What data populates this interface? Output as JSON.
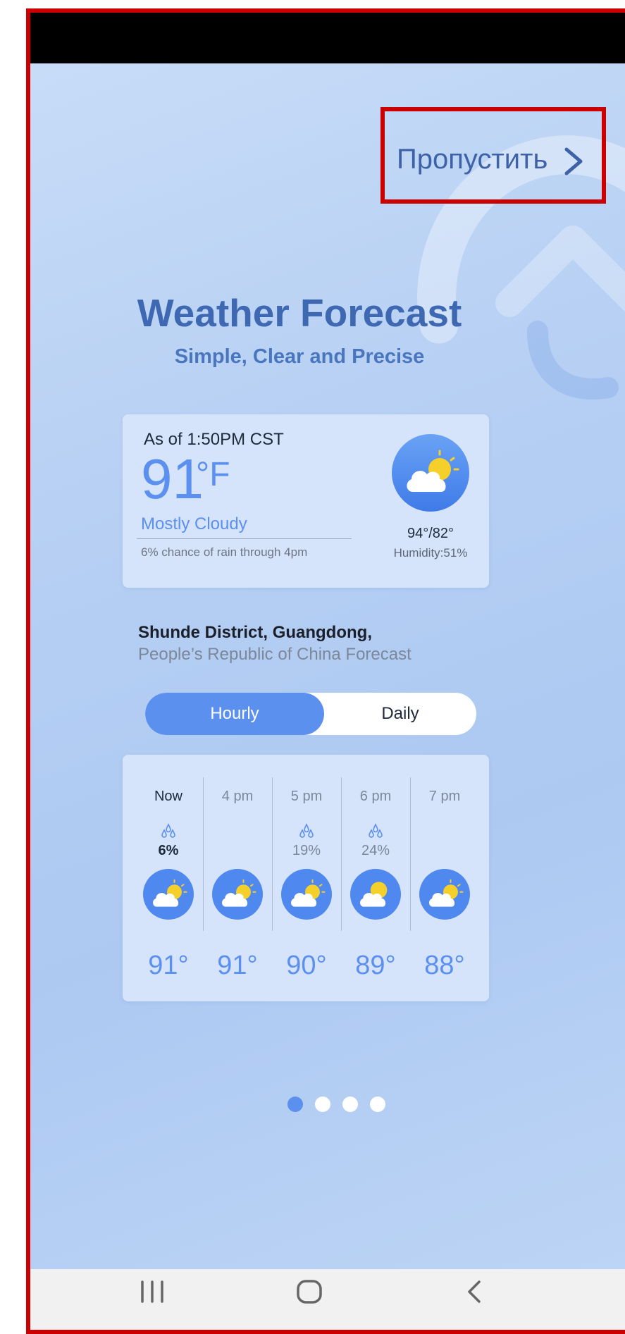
{
  "skip": {
    "label": "Пропустить"
  },
  "header": {
    "title": "Weather Forecast",
    "subtitle": "Simple, Clear and Precise"
  },
  "current": {
    "as_of": "As of 1:50PM CST",
    "temp": "91",
    "unit": "°F",
    "condition": "Mostly Cloudy",
    "rain_note": "6% chance of rain through 4pm",
    "hilo": "94°/82°",
    "humidity": "Humidity:51%",
    "icon": "partly-cloudy-icon"
  },
  "location": {
    "line1": "Shunde District, Guangdong,",
    "line2": "People’s Republic of China Forecast"
  },
  "tabs": {
    "hourly": "Hourly",
    "daily": "Daily",
    "active": "Hourly"
  },
  "hourly": [
    {
      "time": "Now",
      "precip": "6%",
      "temp": "91°",
      "icon": "partly-cloudy-icon"
    },
    {
      "time": "4 pm",
      "precip": "",
      "temp": "91°",
      "icon": "partly-cloudy-icon"
    },
    {
      "time": "5 pm",
      "precip": "19%",
      "temp": "90°",
      "icon": "partly-cloudy-icon"
    },
    {
      "time": "6 pm",
      "precip": "24%",
      "temp": "89°",
      "icon": "partly-cloudy-icon"
    },
    {
      "time": "7 pm",
      "precip": "",
      "temp": "88°",
      "icon": "partly-cloudy-icon"
    }
  ],
  "pager": {
    "total": 4,
    "active": 1
  },
  "colors": {
    "accent": "#5c90ef",
    "title": "#3f68b2",
    "highlight_box": "#cc0000"
  }
}
